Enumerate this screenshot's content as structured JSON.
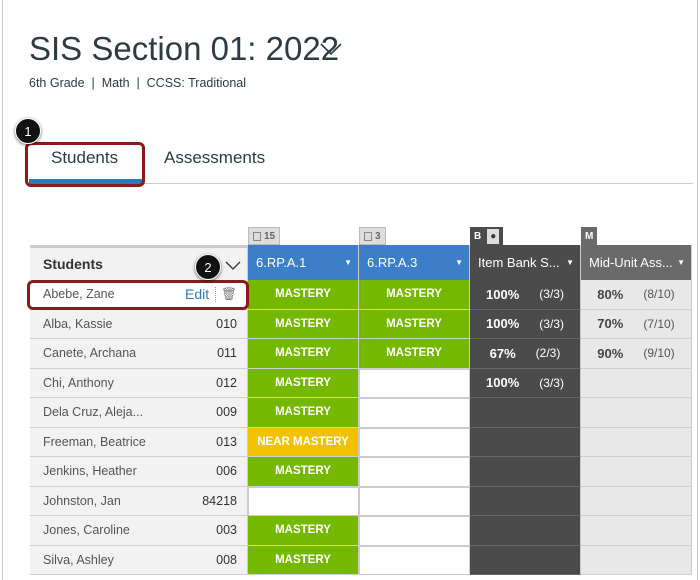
{
  "header": {
    "title": "SIS Section 01: 2022",
    "subtitle": "6th Grade  |  Math  |  CCSS: Traditional"
  },
  "tabs": [
    {
      "label": "Students",
      "active": true
    },
    {
      "label": "Assessments",
      "active": false
    }
  ],
  "callouts": [
    "1",
    "2"
  ],
  "table": {
    "students_header": "Students",
    "edit_label": "Edit",
    "columns": [
      {
        "label": "6.RP.A.1",
        "tag": "15",
        "color": "#3d7ec9"
      },
      {
        "label": "6.RP.A.3",
        "tag": "3",
        "color": "#3d7ec9"
      },
      {
        "label": "Item Bank S...",
        "tag": "B",
        "color": "#4b4b4b"
      },
      {
        "label": "Mid-Unit Ass...",
        "tag": "M",
        "color": "#6a6a6a"
      }
    ],
    "rows": [
      {
        "name": "Abebe, Zane",
        "id": "",
        "a1": "MASTERY",
        "a3": "MASTERY",
        "ib": [
          "100%",
          "(3/3)"
        ],
        "mu": [
          "80%",
          "(8/10)"
        ]
      },
      {
        "name": "Alba, Kassie",
        "id": "010",
        "a1": "MASTERY",
        "a3": "MASTERY",
        "ib": [
          "100%",
          "(3/3)"
        ],
        "mu": [
          "70%",
          "(7/10)"
        ]
      },
      {
        "name": "Canete, Archana",
        "id": "011",
        "a1": "MASTERY",
        "a3": "MASTERY",
        "ib": [
          "67%",
          "(2/3)"
        ],
        "mu": [
          "90%",
          "(9/10)"
        ]
      },
      {
        "name": "Chi, Anthony",
        "id": "012",
        "a1": "MASTERY",
        "a3": "",
        "ib": [
          "100%",
          "(3/3)"
        ],
        "mu": null
      },
      {
        "name": "Dela Cruz, Aleja...",
        "id": "009",
        "a1": "MASTERY",
        "a3": "",
        "ib": null,
        "mu": null
      },
      {
        "name": "Freeman, Beatrice",
        "id": "013",
        "a1": "NEAR MASTERY",
        "a3": "",
        "ib": null,
        "mu": null
      },
      {
        "name": "Jenkins, Heather",
        "id": "006",
        "a1": "MASTERY",
        "a3": "",
        "ib": null,
        "mu": null
      },
      {
        "name": "Johnston, Jan",
        "id": "84218",
        "a1": "",
        "a3": "",
        "ib": null,
        "mu": null
      },
      {
        "name": "Jones, Caroline",
        "id": "003",
        "a1": "MASTERY",
        "a3": "",
        "ib": null,
        "mu": null
      },
      {
        "name": "Silva, Ashley",
        "id": "008",
        "a1": "MASTERY",
        "a3": "",
        "ib": null,
        "mu": null
      }
    ]
  },
  "colors": {
    "mastery": "#74b800",
    "near_mastery": "#f2c200",
    "highlight": "#8b1a1a"
  }
}
